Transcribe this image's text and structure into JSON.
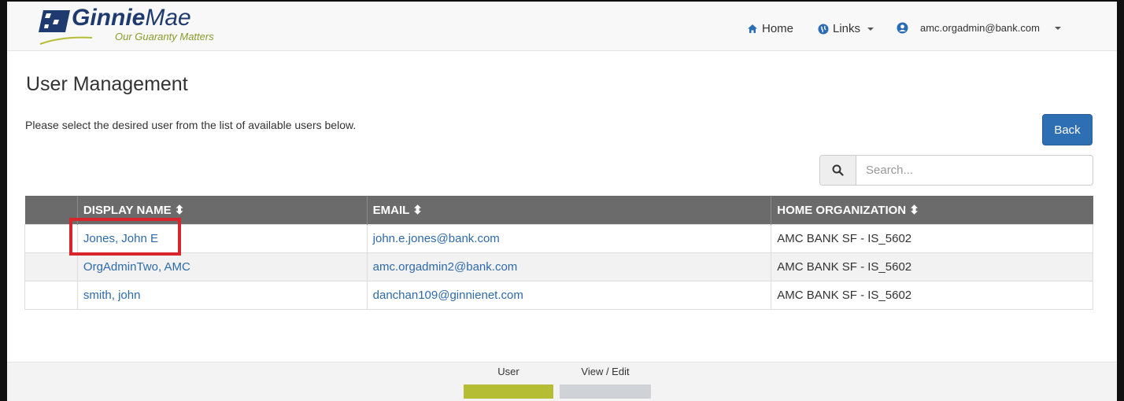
{
  "brand": {
    "name_bold": "Ginnie",
    "name_light": "Mae",
    "tagline": "Our Guaranty Matters"
  },
  "nav": {
    "home_label": "Home",
    "links_label": "Links",
    "user_email": "amc.orgadmin@bank.com"
  },
  "page": {
    "title": "User Management",
    "instructions": "Please select the desired user from the list of available users below.",
    "back_label": "Back"
  },
  "search": {
    "placeholder": "Search..."
  },
  "table": {
    "headers": [
      "DISPLAY NAME ⬍",
      "EMAIL ⬍",
      "HOME ORGANIZATION ⬍"
    ],
    "rows": [
      {
        "display_name": "Jones, John E",
        "email": "john.e.jones@bank.com",
        "home_org": "AMC BANK SF - IS_5602"
      },
      {
        "display_name": "OrgAdminTwo, AMC",
        "email": "amc.orgadmin2@bank.com",
        "home_org": "AMC BANK SF - IS_5602"
      },
      {
        "display_name": "smith, john",
        "email": "danchan109@ginnienet.com",
        "home_org": "AMC BANK SF - IS_5602"
      }
    ]
  },
  "progress": {
    "steps": [
      {
        "label": "User",
        "state": "active",
        "color": "#b5bd35"
      },
      {
        "label": "View / Edit",
        "state": "inactive",
        "color": "#cfd3d7"
      }
    ]
  },
  "colors": {
    "primary": "#2e6eb3",
    "link": "#2e6aa8",
    "table_header": "#6b6b6b",
    "highlight": "#d8242b",
    "brand_navy": "#1e3a6e",
    "brand_green": "#8a9a2a"
  }
}
